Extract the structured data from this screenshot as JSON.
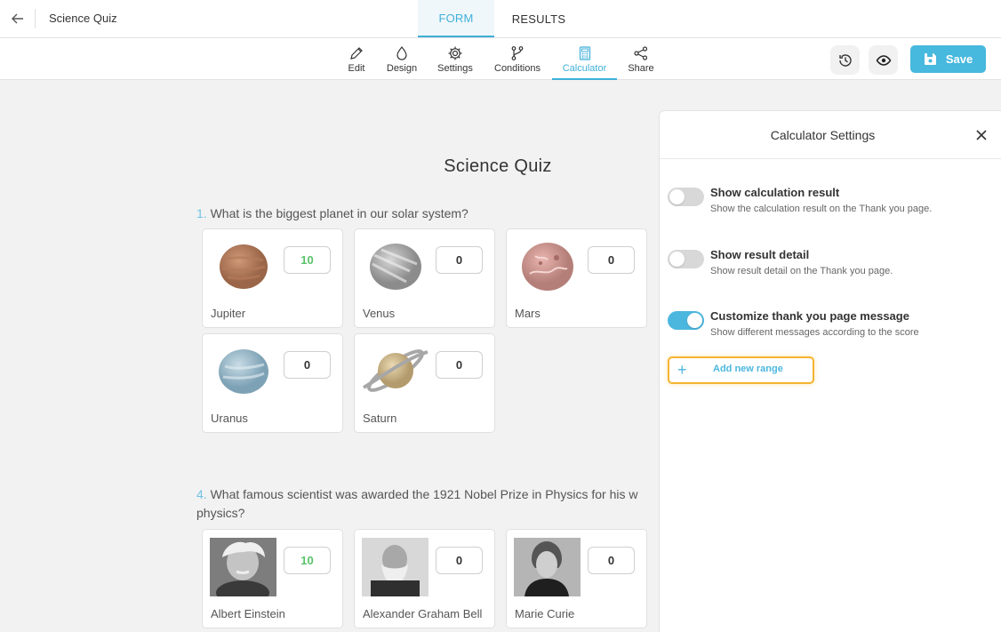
{
  "header": {
    "app_title": "Science Quiz",
    "tabs": [
      {
        "label": "FORM",
        "active": true
      },
      {
        "label": "RESULTS",
        "active": false
      }
    ]
  },
  "toolbar": {
    "tools": [
      {
        "label": "Edit",
        "icon": "pencil-icon"
      },
      {
        "label": "Design",
        "icon": "drop-icon"
      },
      {
        "label": "Settings",
        "icon": "gear-icon"
      },
      {
        "label": "Conditions",
        "icon": "branch-icon"
      },
      {
        "label": "Calculator",
        "icon": "calculator-icon",
        "active": true
      },
      {
        "label": "Share",
        "icon": "share-icon"
      }
    ],
    "save_label": "Save"
  },
  "form": {
    "title": "Science Quiz",
    "questions": [
      {
        "number": "1.",
        "text": "What is the biggest planet in our solar system?",
        "options": [
          {
            "label": "Jupiter",
            "score": "10"
          },
          {
            "label": "Venus",
            "score": "0"
          },
          {
            "label": "Mars",
            "score": "0"
          },
          {
            "label": "Uranus",
            "score": "0"
          },
          {
            "label": "Saturn",
            "score": "0"
          }
        ]
      },
      {
        "number": "4.",
        "text": "What famous scientist was awarded the 1921 Nobel Prize in Physics for his w",
        "text_line2": "physics?",
        "options": [
          {
            "label": "Albert Einstein",
            "score": "10"
          },
          {
            "label": "Alexander Graham Bell",
            "score": "0"
          },
          {
            "label": "Marie Curie",
            "score": "0"
          }
        ]
      }
    ]
  },
  "panel": {
    "title": "Calculator Settings",
    "options": [
      {
        "title": "Show calculation result",
        "desc": "Show the calculation result on the Thank you page.",
        "enabled": false
      },
      {
        "title": "Show result detail",
        "desc": "Show result detail on the Thank you page.",
        "enabled": false
      },
      {
        "title": "Customize thank you page message",
        "desc": "Show different messages according to the score",
        "enabled": true
      }
    ],
    "add_range_label": "Add new range"
  },
  "colors": {
    "accent": "#3fb0d9",
    "save": "#47b8de",
    "highlight": "#f5b430",
    "score_good": "#59c26a"
  }
}
